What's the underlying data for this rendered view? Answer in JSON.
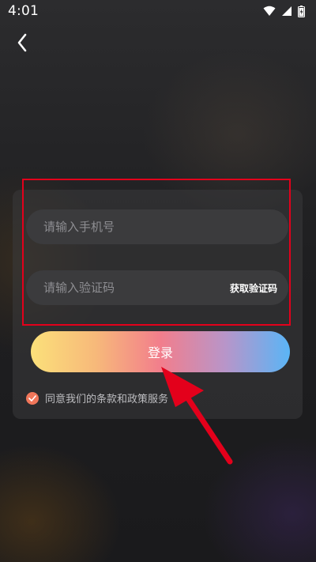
{
  "status_bar": {
    "time": "4:01",
    "icons": [
      "wifi-icon",
      "signal-icon",
      "battery-icon"
    ]
  },
  "nav": {
    "back_icon": "chevron-left-icon"
  },
  "form": {
    "phone_placeholder": "请输入手机号",
    "code_placeholder": "请输入验证码",
    "get_code_label": "获取验证码",
    "login_label": "登录",
    "agree_text": "同意我们的条款和政策服务",
    "agree_checked": true
  },
  "annotation": {
    "highlight_color": "#e3001b",
    "arrow_color": "#e3001b"
  },
  "colors": {
    "checkbox": "#f0765a",
    "button_gradient": [
      "#fbe07a",
      "#f27e8c",
      "#5ab5f6"
    ]
  }
}
